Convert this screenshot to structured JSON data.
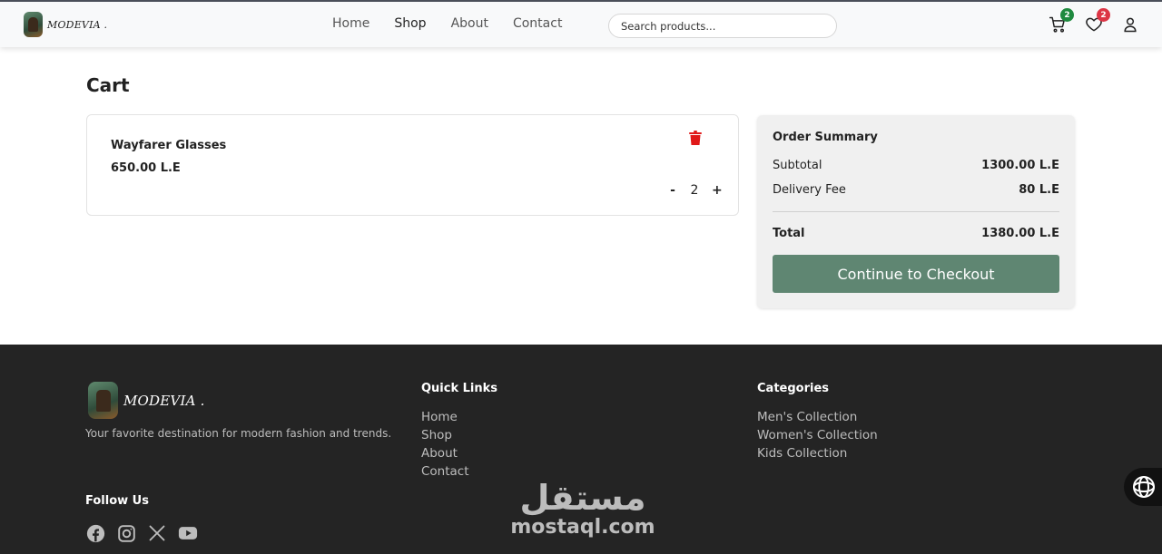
{
  "brand": {
    "name": "MODEVIA ."
  },
  "nav": {
    "items": [
      "Home",
      "Shop",
      "About",
      "Contact"
    ],
    "active": "Shop"
  },
  "search": {
    "placeholder": "Search products..."
  },
  "header_icons": {
    "cart_count": "2",
    "wishlist_count": "2",
    "cart_badge_color": "#1f8a3f",
    "wishlist_badge_color": "#dc3545"
  },
  "cart": {
    "title": "Cart",
    "items": [
      {
        "name": "Wayfarer Glasses",
        "price": "650.00 L.E",
        "quantity": "2",
        "decrease": "-",
        "increase": "+"
      }
    ]
  },
  "summary": {
    "title": "Order Summary",
    "subtotal_label": "Subtotal",
    "subtotal_value": "1300.00 L.E",
    "delivery_label": "Delivery Fee",
    "delivery_value": "80 L.E",
    "total_label": "Total",
    "total_value": "1380.00 L.E",
    "checkout_label": "Continue to Checkout",
    "accent": "#5f8672"
  },
  "footer": {
    "brand": "MODEVIA .",
    "tagline": "Your favorite destination for modern fashion and trends.",
    "quick_links_title": "Quick Links",
    "quick_links": [
      "Home",
      "Shop",
      "About",
      "Contact"
    ],
    "categories_title": "Categories",
    "categories": [
      "Men's Collection",
      "Women's Collection",
      "Kids Collection"
    ],
    "follow_title": "Follow Us",
    "social_icons": [
      "facebook-icon",
      "instagram-icon",
      "x-icon",
      "youtube-icon"
    ]
  },
  "watermark": {
    "arabic": "مستقل",
    "latin": "mostaql.com"
  }
}
